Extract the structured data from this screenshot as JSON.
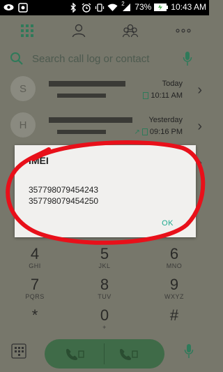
{
  "status_bar": {
    "battery": "73%",
    "clock": "10:43 AM",
    "signal_badge": "2",
    "icons_left": [
      "eye-icon",
      "app-notification-icon"
    ],
    "icons_right": [
      "bluetooth-icon",
      "alarm-icon",
      "vibrate-icon",
      "wifi-icon",
      "signal-icon",
      "battery-charging-icon"
    ]
  },
  "tabs": [
    {
      "name": "dialpad-tab",
      "icon": "grid-icon",
      "selected": true
    },
    {
      "name": "contacts-tab",
      "icon": "person-icon",
      "selected": false
    },
    {
      "name": "groups-tab",
      "icon": "group-icon",
      "selected": false
    },
    {
      "name": "more-tab",
      "icon": "more-icon",
      "selected": false
    }
  ],
  "search": {
    "placeholder": "Search call log or contact"
  },
  "call_log": [
    {
      "initial": "S",
      "when": "Today",
      "time": "10:11 AM",
      "direction": "incoming"
    },
    {
      "initial": "H",
      "when": "Yesterday",
      "time": "09:16 PM",
      "direction": "outgoing"
    }
  ],
  "dialog": {
    "title": "IMEI",
    "imei1": "357798079454243",
    "imei2": "357798079454250",
    "ok_label": "OK"
  },
  "keypad": [
    {
      "num": "4",
      "letters": "GHI"
    },
    {
      "num": "5",
      "letters": "JKL"
    },
    {
      "num": "6",
      "letters": "MNO"
    },
    {
      "num": "7",
      "letters": "PQRS"
    },
    {
      "num": "8",
      "letters": "TUV"
    },
    {
      "num": "9",
      "letters": "WXYZ"
    },
    {
      "num": "*",
      "letters": ""
    },
    {
      "num": "0",
      "letters": "+"
    },
    {
      "num": "#",
      "letters": ""
    }
  ],
  "colors": {
    "accent": "#1fa98f",
    "call_button": "#3f6b48",
    "overlay": "#77776b",
    "annotation": "#e8101a"
  }
}
